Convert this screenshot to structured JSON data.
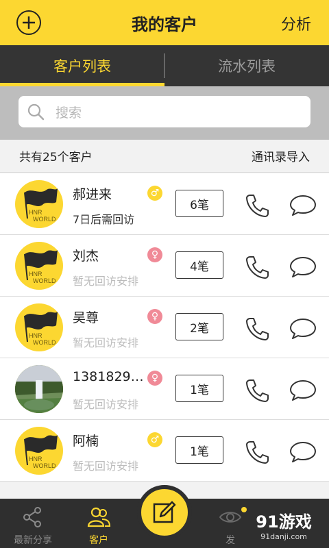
{
  "header": {
    "title": "我的客户",
    "right_label": "分析"
  },
  "tabs": [
    {
      "label": "客户列表",
      "active": true
    },
    {
      "label": "流水列表",
      "active": false
    }
  ],
  "search": {
    "placeholder": "搜索"
  },
  "summary": {
    "count_text": "共有25个客户",
    "import_label": "通讯录导入"
  },
  "customers": [
    {
      "name": "郝进来",
      "gender": "male",
      "gender_symbol": "♂",
      "followup": "7日后需回访",
      "followup_state": "active",
      "count": "6笔",
      "avatar": "hnr-world-logo"
    },
    {
      "name": "刘杰",
      "gender": "female",
      "gender_symbol": "♀",
      "followup": "暂无回访安排",
      "followup_state": "none",
      "count": "4笔",
      "avatar": "hnr-world-logo"
    },
    {
      "name": "吴尊",
      "gender": "female",
      "gender_symbol": "♀",
      "followup": "暂无回访安排",
      "followup_state": "none",
      "count": "2笔",
      "avatar": "hnr-world-logo"
    },
    {
      "name": "1381829…",
      "gender": "female",
      "gender_symbol": "♀",
      "followup": "暂无回访安排",
      "followup_state": "none",
      "count": "1笔",
      "avatar": "waterfall-photo"
    },
    {
      "name": "阿楠",
      "gender": "male",
      "gender_symbol": "♂",
      "followup": "暂无回访安排",
      "followup_state": "none",
      "count": "1笔",
      "avatar": "hnr-world-logo"
    }
  ],
  "bottom_nav": {
    "share_label": "最新分享",
    "customer_label": "客户",
    "third_label": "发"
  },
  "watermark": {
    "title": "91游戏",
    "domain": "91danji.com"
  },
  "colors": {
    "accent": "#fcd731",
    "dark": "#343434",
    "female": "#f08a97"
  }
}
